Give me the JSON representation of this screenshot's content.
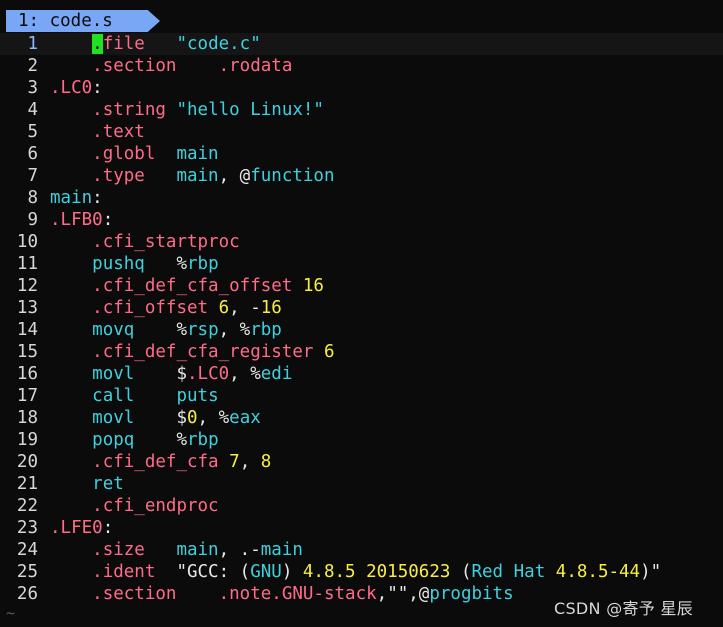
{
  "tab": {
    "label": "1: code.s"
  },
  "current_line": 1,
  "colors": {
    "background": "#0b0b0b",
    "directive": "#ff6b89",
    "instruction": "#3fd0de",
    "number": "#f7ef3f",
    "cursor": "#22e022",
    "tab_bg": "#7aa7f5"
  },
  "lines": [
    {
      "num": "1",
      "tokens": [
        [
          "p",
          "    "
        ],
        [
          "cursor",
          "."
        ],
        [
          "d",
          "file"
        ],
        [
          "p",
          "   "
        ],
        [
          "s",
          "\"code.c\""
        ]
      ]
    },
    {
      "num": "2",
      "tokens": [
        [
          "p",
          "    "
        ],
        [
          "d",
          ".section"
        ],
        [
          "p",
          "    "
        ],
        [
          "d",
          ".rodata"
        ]
      ]
    },
    {
      "num": "3",
      "tokens": [
        [
          "l",
          ".LC0"
        ],
        [
          "p",
          ":"
        ]
      ]
    },
    {
      "num": "4",
      "tokens": [
        [
          "p",
          "    "
        ],
        [
          "d",
          ".string"
        ],
        [
          "p",
          " "
        ],
        [
          "s",
          "\"hello Linux!\""
        ]
      ]
    },
    {
      "num": "5",
      "tokens": [
        [
          "p",
          "    "
        ],
        [
          "d",
          ".text"
        ]
      ]
    },
    {
      "num": "6",
      "tokens": [
        [
          "p",
          "    "
        ],
        [
          "d",
          ".globl"
        ],
        [
          "p",
          "  "
        ],
        [
          "i",
          "main"
        ]
      ]
    },
    {
      "num": "7",
      "tokens": [
        [
          "p",
          "    "
        ],
        [
          "d",
          ".type"
        ],
        [
          "p",
          "   "
        ],
        [
          "i",
          "main"
        ],
        [
          "p",
          ", @"
        ],
        [
          "i",
          "function"
        ]
      ]
    },
    {
      "num": "8",
      "tokens": [
        [
          "i",
          "main"
        ],
        [
          "p",
          ":"
        ]
      ]
    },
    {
      "num": "9",
      "tokens": [
        [
          "l",
          ".LFB0"
        ],
        [
          "p",
          ":"
        ]
      ]
    },
    {
      "num": "10",
      "tokens": [
        [
          "p",
          "    "
        ],
        [
          "d",
          ".cfi_startproc"
        ]
      ]
    },
    {
      "num": "11",
      "tokens": [
        [
          "p",
          "    "
        ],
        [
          "i",
          "pushq"
        ],
        [
          "p",
          "   %"
        ],
        [
          "r",
          "rbp"
        ]
      ]
    },
    {
      "num": "12",
      "tokens": [
        [
          "p",
          "    "
        ],
        [
          "d",
          ".cfi_def_cfa_offset"
        ],
        [
          "p",
          " "
        ],
        [
          "n",
          "16"
        ]
      ]
    },
    {
      "num": "13",
      "tokens": [
        [
          "p",
          "    "
        ],
        [
          "d",
          ".cfi_offset"
        ],
        [
          "p",
          " "
        ],
        [
          "n",
          "6"
        ],
        [
          "p",
          ", -"
        ],
        [
          "n",
          "16"
        ]
      ]
    },
    {
      "num": "14",
      "tokens": [
        [
          "p",
          "    "
        ],
        [
          "i",
          "movq"
        ],
        [
          "p",
          "    %"
        ],
        [
          "r",
          "rsp"
        ],
        [
          "p",
          ", %"
        ],
        [
          "r",
          "rbp"
        ]
      ]
    },
    {
      "num": "15",
      "tokens": [
        [
          "p",
          "    "
        ],
        [
          "d",
          ".cfi_def_cfa_register"
        ],
        [
          "p",
          " "
        ],
        [
          "n",
          "6"
        ]
      ]
    },
    {
      "num": "16",
      "tokens": [
        [
          "p",
          "    "
        ],
        [
          "i",
          "movl"
        ],
        [
          "p",
          "    $"
        ],
        [
          "l",
          ".LC0"
        ],
        [
          "p",
          ", %"
        ],
        [
          "r",
          "edi"
        ]
      ]
    },
    {
      "num": "17",
      "tokens": [
        [
          "p",
          "    "
        ],
        [
          "i",
          "call"
        ],
        [
          "p",
          "    "
        ],
        [
          "i",
          "puts"
        ]
      ]
    },
    {
      "num": "18",
      "tokens": [
        [
          "p",
          "    "
        ],
        [
          "i",
          "movl"
        ],
        [
          "p",
          "    $"
        ],
        [
          "n",
          "0"
        ],
        [
          "p",
          ", %"
        ],
        [
          "r",
          "eax"
        ]
      ]
    },
    {
      "num": "19",
      "tokens": [
        [
          "p",
          "    "
        ],
        [
          "i",
          "popq"
        ],
        [
          "p",
          "    %"
        ],
        [
          "r",
          "rbp"
        ]
      ]
    },
    {
      "num": "20",
      "tokens": [
        [
          "p",
          "    "
        ],
        [
          "d",
          ".cfi_def_cfa"
        ],
        [
          "p",
          " "
        ],
        [
          "n",
          "7"
        ],
        [
          "p",
          ", "
        ],
        [
          "n",
          "8"
        ]
      ]
    },
    {
      "num": "21",
      "tokens": [
        [
          "p",
          "    "
        ],
        [
          "i",
          "ret"
        ]
      ]
    },
    {
      "num": "22",
      "tokens": [
        [
          "p",
          "    "
        ],
        [
          "d",
          ".cfi_endproc"
        ]
      ]
    },
    {
      "num": "23",
      "tokens": [
        [
          "l",
          ".LFE0"
        ],
        [
          "p",
          ":"
        ]
      ]
    },
    {
      "num": "24",
      "tokens": [
        [
          "p",
          "    "
        ],
        [
          "d",
          ".size"
        ],
        [
          "p",
          "   "
        ],
        [
          "i",
          "main"
        ],
        [
          "p",
          ", .-"
        ],
        [
          "i",
          "main"
        ]
      ]
    },
    {
      "num": "25",
      "tokens": [
        [
          "p",
          "    "
        ],
        [
          "d",
          ".ident"
        ],
        [
          "p",
          "  \"GCC: ("
        ],
        [
          "i",
          "GNU"
        ],
        [
          "p",
          ") "
        ],
        [
          "n",
          "4.8.5 20150623"
        ],
        [
          "p",
          " ("
        ],
        [
          "i",
          "Red Hat"
        ],
        [
          "p",
          " "
        ],
        [
          "n",
          "4.8.5-44"
        ],
        [
          "p",
          ")\""
        ]
      ]
    },
    {
      "num": "26",
      "tokens": [
        [
          "p",
          "    "
        ],
        [
          "d",
          ".section"
        ],
        [
          "p",
          "    "
        ],
        [
          "d",
          ".note.GNU-stack"
        ],
        [
          "p",
          ",\"\",@"
        ],
        [
          "i",
          "progbits"
        ]
      ]
    }
  ],
  "empty_marker": "~",
  "watermark": "CSDN @寄予 星辰"
}
